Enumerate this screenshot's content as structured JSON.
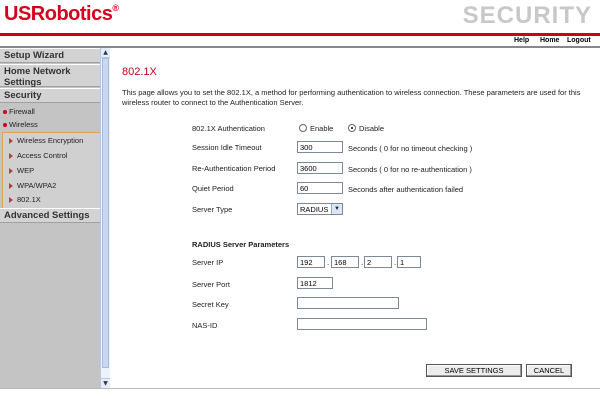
{
  "header": {
    "logo": "USRobotics",
    "logo_tm": "®",
    "section": "SECURITY",
    "links": [
      "Help",
      "Home",
      "Logout"
    ]
  },
  "sidebar": {
    "items": [
      {
        "label": "Setup Wizard"
      },
      {
        "label": "Home Network Settings"
      },
      {
        "label": "Security"
      },
      {
        "label": "Firewall"
      },
      {
        "label": "Wireless"
      },
      {
        "label": "Wireless Encryption"
      },
      {
        "label": "Access Control"
      },
      {
        "label": "WEP"
      },
      {
        "label": "WPA/WPA2"
      },
      {
        "label": "802.1X"
      },
      {
        "label": "Advanced Settings"
      }
    ]
  },
  "main": {
    "title": "802.1X",
    "description": "This page allows you to set the 802.1X, a method for performing authentication to wireless connection.  These parameters are used for this wireless router to connect to the Authentication Server.",
    "auth_label": "802.1X Authentication",
    "auth_enable": "Enable",
    "auth_disable": "Disable",
    "auth_selected": "Disable",
    "idle_label": "Session Idle Timeout",
    "idle_value": "300",
    "idle_note": "Seconds ( 0 for no timeout checking )",
    "reauth_label": "Re-Authentication Period",
    "reauth_value": "3600",
    "reauth_note": "Seconds ( 0 for no re-authentication )",
    "quiet_label": "Quiet Period",
    "quiet_value": "60",
    "quiet_note": "Seconds after authentication failed",
    "server_type_label": "Server Type",
    "server_type_value": "RADIUS",
    "radius_heading": "RADIUS Server Parameters",
    "server_ip_label": "Server IP",
    "server_ip": [
      "192",
      "168",
      "2",
      "1"
    ],
    "server_port_label": "Server Port",
    "server_port": "1812",
    "secret_label": "Secret Key",
    "secret_value": "",
    "nasid_label": "NAS-ID",
    "nasid_value": "",
    "save_label": "SAVE SETTINGS",
    "cancel_label": "CANCEL"
  }
}
